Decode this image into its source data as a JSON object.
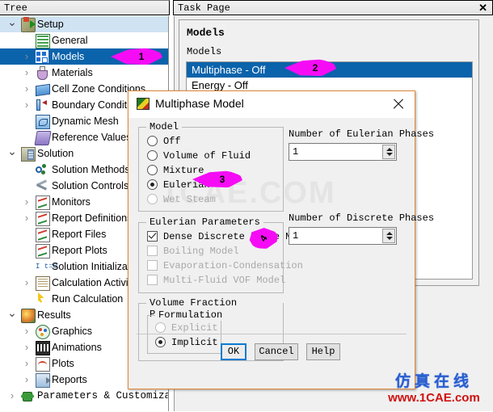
{
  "tree_panel": {
    "header": "Tree",
    "nodes": [
      {
        "label": "Setup",
        "icon": "setup-icon",
        "indent": 26,
        "twist": "v",
        "state": "highlight"
      },
      {
        "label": "General",
        "icon": "general-icon",
        "indent": 44,
        "twist": "",
        "state": "normal"
      },
      {
        "label": "Models",
        "icon": "models-icon",
        "indent": 44,
        "twist": ">",
        "state": "selected"
      },
      {
        "label": "Materials",
        "icon": "materials-icon",
        "indent": 44,
        "twist": ">",
        "state": "normal"
      },
      {
        "label": "Cell Zone Conditions",
        "icon": "cell-zone-icon",
        "indent": 44,
        "twist": ">",
        "state": "normal"
      },
      {
        "label": "Boundary Conditions",
        "icon": "boundary-conditions-icon",
        "indent": 44,
        "twist": ">",
        "state": "normal"
      },
      {
        "label": "Dynamic Mesh",
        "icon": "dynamic-mesh-icon",
        "indent": 44,
        "twist": "",
        "state": "normal"
      },
      {
        "label": "Reference Values",
        "icon": "reference-values-icon",
        "indent": 44,
        "twist": "",
        "state": "normal"
      },
      {
        "label": "Solution",
        "icon": "solution-icon",
        "indent": 26,
        "twist": "v",
        "state": "normal"
      },
      {
        "label": "Solution Methods",
        "icon": "solution-methods-icon",
        "indent": 44,
        "twist": "",
        "state": "normal"
      },
      {
        "label": "Solution Controls",
        "icon": "solution-controls-icon",
        "indent": 44,
        "twist": "",
        "state": "normal"
      },
      {
        "label": "Monitors",
        "icon": "monitors-icon",
        "indent": 44,
        "twist": ">",
        "state": "normal"
      },
      {
        "label": "Report Definitions",
        "icon": "report-definitions-icon",
        "indent": 44,
        "twist": ">",
        "state": "normal"
      },
      {
        "label": "Report Files",
        "icon": "report-files-icon",
        "indent": 44,
        "twist": "",
        "state": "normal"
      },
      {
        "label": "Report Plots",
        "icon": "report-plots-icon",
        "indent": 44,
        "twist": "",
        "state": "normal"
      },
      {
        "label": "Solution Initialization",
        "icon": "solution-initialization-icon",
        "indent": 44,
        "twist": "",
        "state": "normal"
      },
      {
        "label": "Calculation Activities",
        "icon": "calculation-activities-icon",
        "indent": 44,
        "twist": ">",
        "state": "normal"
      },
      {
        "label": "Run Calculation",
        "icon": "run-calculation-icon",
        "indent": 44,
        "twist": "",
        "state": "normal"
      },
      {
        "label": "Results",
        "icon": "results-icon",
        "indent": 26,
        "twist": "v",
        "state": "normal"
      },
      {
        "label": "Graphics",
        "icon": "graphics-icon",
        "indent": 44,
        "twist": ">",
        "state": "normal"
      },
      {
        "label": "Animations",
        "icon": "animations-icon",
        "indent": 44,
        "twist": ">",
        "state": "normal"
      },
      {
        "label": "Plots",
        "icon": "plots-icon",
        "indent": 44,
        "twist": ">",
        "state": "normal"
      },
      {
        "label": "Reports",
        "icon": "reports-icon",
        "indent": 44,
        "twist": ">",
        "state": "normal"
      },
      {
        "label": "Parameters & Customization",
        "icon": "parameters-icon",
        "indent": 26,
        "twist": ">",
        "state": "normal"
      }
    ]
  },
  "task_panel": {
    "header": "Task Page",
    "title": "Models",
    "subtitle": "Models",
    "items": [
      {
        "label": "Multiphase - Off",
        "selected": true
      },
      {
        "label": "Energy - Off",
        "selected": false
      }
    ]
  },
  "dialog": {
    "title": "Multiphase Model",
    "model_group": {
      "legend": "Model",
      "options": [
        {
          "label": "Off",
          "selected": false,
          "disabled": false
        },
        {
          "label": "Volume of Fluid",
          "selected": false,
          "disabled": false
        },
        {
          "label": "Mixture",
          "selected": false,
          "disabled": false
        },
        {
          "label": "Eulerian",
          "selected": true,
          "disabled": false
        },
        {
          "label": "Wet Steam",
          "selected": false,
          "disabled": true
        }
      ]
    },
    "eulerian_group": {
      "legend": "Eulerian Parameters",
      "checkboxes": [
        {
          "label": "Dense Discrete Phase Model",
          "checked": true,
          "disabled": false
        },
        {
          "label": "Boiling Model",
          "checked": false,
          "disabled": true
        },
        {
          "label": "Evaporation-Condensation",
          "checked": false,
          "disabled": true
        },
        {
          "label": "Multi-Fluid VOF Model",
          "checked": false,
          "disabled": true
        }
      ]
    },
    "volume_fraction_group": {
      "legend": "Volume Fraction Parameters",
      "formulation_legend": "Formulation",
      "options": [
        {
          "label": "Explicit",
          "selected": false,
          "disabled": true
        },
        {
          "label": "Implicit",
          "selected": true,
          "disabled": false
        }
      ]
    },
    "eulerian_phases": {
      "label": "Number of Eulerian Phases",
      "value": "1"
    },
    "discrete_phases": {
      "label": "Number of Discrete Phases",
      "value": "1"
    },
    "buttons": [
      {
        "label": "OK",
        "focused": true
      },
      {
        "label": "Cancel",
        "focused": false
      },
      {
        "label": "Help",
        "focused": false
      }
    ]
  },
  "callouts": [
    {
      "number": "1",
      "kind": "left"
    },
    {
      "number": "2",
      "kind": "left"
    },
    {
      "number": "3",
      "kind": "left"
    },
    {
      "number": "4",
      "kind": "up"
    }
  ],
  "watermark": {
    "center": "1CAE.COM",
    "corner_cn": "仿真在线",
    "corner_en": "www.1CAE.com"
  },
  "colors": {
    "selection_blue": "#0a63ab",
    "callout_magenta": "#f50cf5",
    "focus_blue": "#0a7bd0",
    "dialog_border_orange": "#e08a3c"
  }
}
